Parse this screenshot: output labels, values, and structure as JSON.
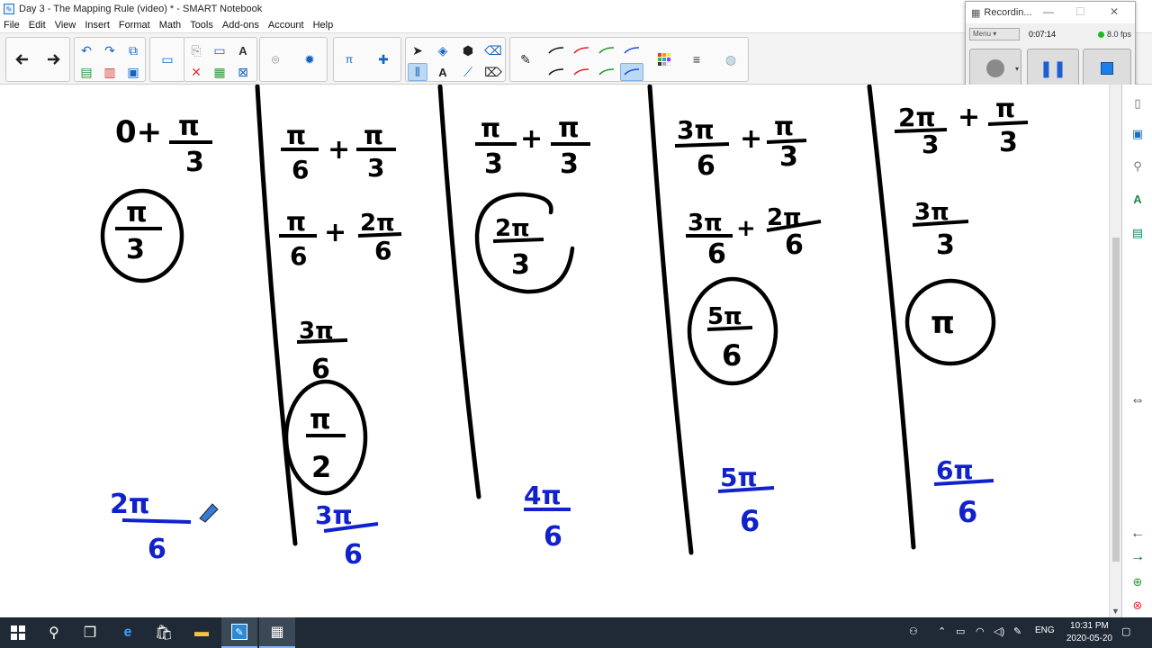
{
  "window": {
    "title": "Day 3 - The Mapping Rule (video) * - SMART Notebook"
  },
  "menu": [
    "File",
    "Edit",
    "View",
    "Insert",
    "Format",
    "Math",
    "Tools",
    "Add-ons",
    "Account",
    "Help"
  ],
  "toolbar": {
    "icons": [
      "back-arrow-icon",
      "forward-arrow-icon",
      "undo-icon",
      "redo-icon",
      "add-page-icon",
      "paste-icon",
      "delete-page-icon",
      "save-icon",
      "screen-shade-icon",
      "display-icon",
      "text-formatting-icon",
      "delete-icon",
      "table-icon",
      "capture-icon",
      "addon-icon",
      "math-icon",
      "puzzle-icon",
      "select-icon",
      "shapes-icon",
      "fill-icon",
      "eraser-icon",
      "pen-icon",
      "color-palette-icon",
      "line-style-icon",
      "magic-pen-icon"
    ]
  },
  "recorder": {
    "title": "Recordin...",
    "menu_label": "Menu",
    "elapsed": "0:07:14",
    "fps": "8.0 fps"
  },
  "whiteboard": {
    "columns": [
      {
        "expression": "0+π/3",
        "circled": "π/3",
        "answer": "2π/6"
      },
      {
        "expression": "π/6+π/3",
        "step2": "π/6+2π/6",
        "step3": "3π/6",
        "circled": "π/2",
        "answer": "3π/6"
      },
      {
        "expression": "π/3+π/3",
        "circled": "2π/3",
        "answer": "4π/6"
      },
      {
        "expression": "3π/6+π/3",
        "step2": "3π/6+2π/6",
        "circled": "5π/6",
        "answer": "5π/6"
      },
      {
        "expression": "2π/3+π/3",
        "step2": "3π/3",
        "circled": "π",
        "answer": "6π/6"
      }
    ]
  },
  "taskbar": {
    "language": "ENG",
    "time": "10:31 PM",
    "date": "2020-05-20"
  }
}
